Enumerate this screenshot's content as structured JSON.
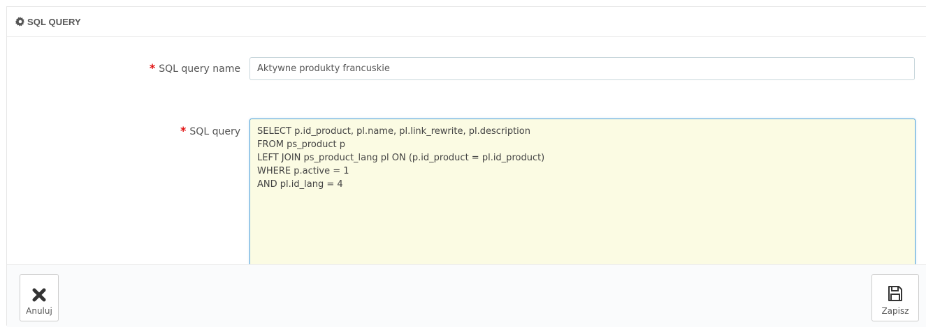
{
  "panel": {
    "title": "SQL QUERY",
    "title_icon": "gear-icon"
  },
  "form": {
    "name_field": {
      "label": "SQL query name",
      "required_mark": "*",
      "value": "Aktywne produkty francuskie"
    },
    "query_field": {
      "label": "SQL query",
      "required_mark": "*",
      "lines": [
        "SELECT p.id_product, pl.name, pl.link_rewrite, pl.description",
        "FROM ps_product p",
        "LEFT JOIN ps_product_lang pl ON (p.id_product = pl.id_product)",
        "WHERE p.active = 1",
        "AND pl.id_lang = 4"
      ]
    }
  },
  "footer": {
    "cancel_label": "Anuluj",
    "cancel_icon": "close-icon",
    "save_label": "Zapisz",
    "save_icon": "floppy-disk-icon"
  },
  "colors": {
    "required": "#e00d0d",
    "textarea_bg": "#fbfbe3",
    "focus_border": "#4a9ed6"
  }
}
